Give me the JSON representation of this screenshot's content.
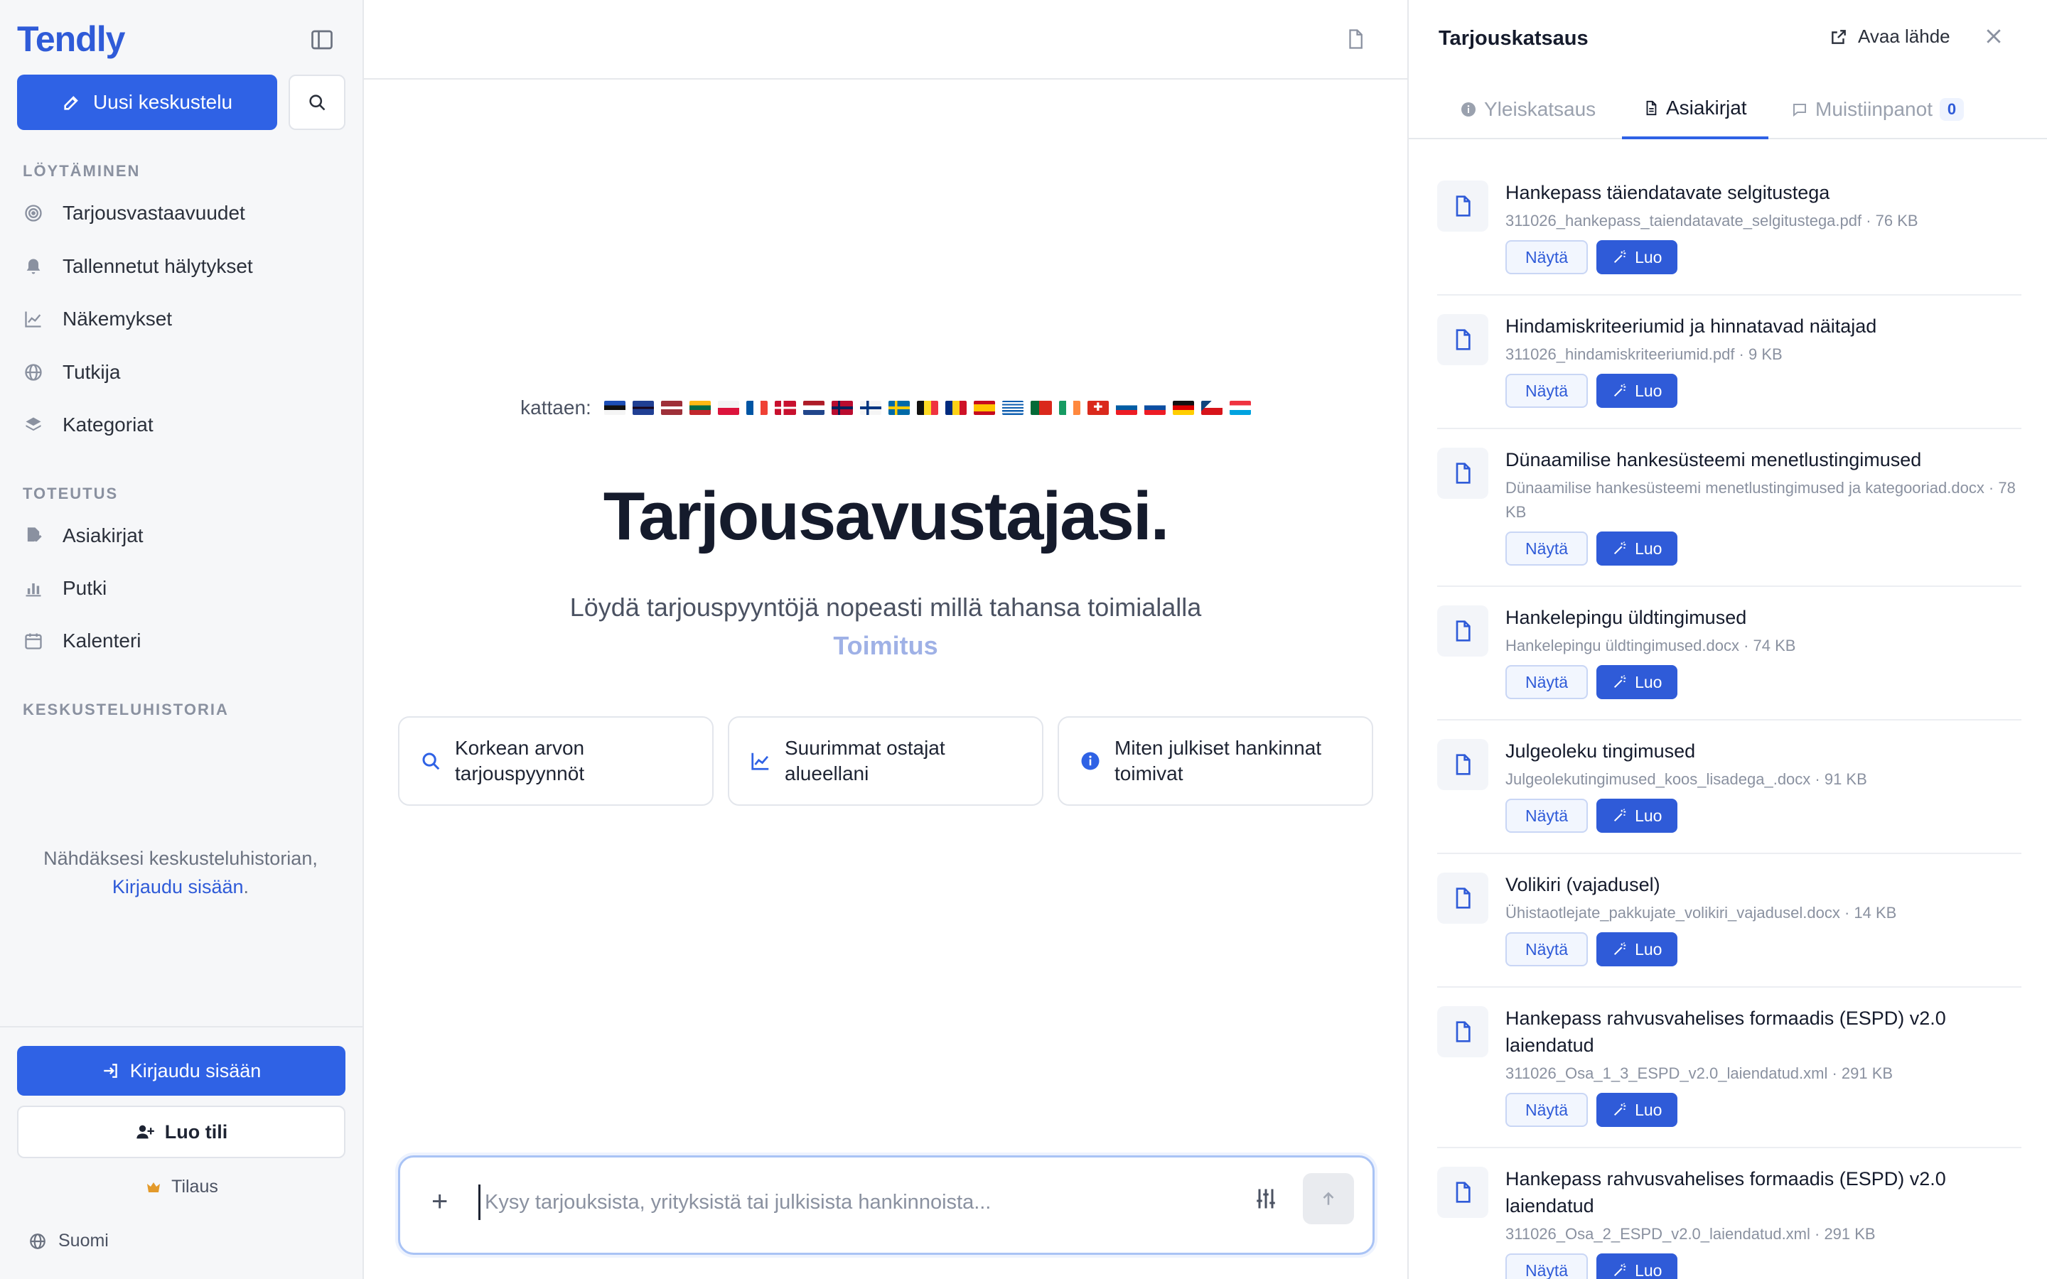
{
  "sidebar": {
    "brand": "Tendly",
    "new_chat": "Uusi keskustelu",
    "section_discover": "LÖYTÄMINEN",
    "nav_discover": [
      {
        "label": "Tarjousvastaavuudet",
        "icon": "target-icon"
      },
      {
        "label": "Tallennetut hälytykset",
        "icon": "bell-icon"
      },
      {
        "label": "Näkemykset",
        "icon": "chart-line-icon"
      },
      {
        "label": "Tutkija",
        "icon": "globe-icon"
      },
      {
        "label": "Kategoriat",
        "icon": "layers-icon"
      }
    ],
    "section_execute": "TOTEUTUS",
    "nav_execute": [
      {
        "label": "Asiakirjat",
        "icon": "document-edit-icon"
      },
      {
        "label": "Putki",
        "icon": "bar-chart-icon"
      },
      {
        "label": "Kalenteri",
        "icon": "calendar-icon"
      }
    ],
    "section_history": "KESKUSTELUHISTORIA",
    "history_msg_prefix": "Nähdäksesi keskusteluhistorian,",
    "history_msg_link": "Kirjaudu sisään",
    "history_msg_suffix": ".",
    "login": "Kirjaudu sisään",
    "create_account": "Luo tili",
    "plan": "Tilaus",
    "language": "Suomi"
  },
  "main": {
    "flags_label": "kattaen:",
    "flags": [
      "EE",
      "GB",
      "LV",
      "LT",
      "PL",
      "FR",
      "DK",
      "NL",
      "NO",
      "FI",
      "SE",
      "BE",
      "RO",
      "ES",
      "GR",
      "PT",
      "IE",
      "CH",
      "SI",
      "SK",
      "DE",
      "CZ",
      "LU"
    ],
    "title": "Tarjousavustajasi.",
    "subtitle": "Löydä tarjouspyyntöjä nopeasti millä tahansa toimialalla",
    "accent": "Toimitus",
    "suggestions": [
      {
        "label": "Korkean arvon tarjouspyynnöt",
        "icon": "search-icon"
      },
      {
        "label": "Suurimmat ostajat alueellani",
        "icon": "chart-line-icon"
      },
      {
        "label": "Miten julkiset hankinnat toimivat",
        "icon": "info-icon"
      }
    ],
    "composer_placeholder": "Kysy tarjouksista, yrityksistä tai julkisista hankinnoista..."
  },
  "panel": {
    "title": "Tarjouskatsaus",
    "open_source": "Avaa lähde",
    "tabs": [
      {
        "label": "Yleiskatsaus",
        "icon": "info-icon"
      },
      {
        "label": "Asiakirjat",
        "icon": "document-icon"
      },
      {
        "label": "Muistiinpanot",
        "icon": "chat-icon",
        "count": "0"
      }
    ],
    "view_label": "Näytä",
    "create_label": "Luo",
    "documents": [
      {
        "name": "Hankepass täiendatavate selgitustega",
        "meta": "311026_hankepass_taiendatavate_selgitustega.pdf · 76 KB"
      },
      {
        "name": "Hindamiskriteeriumid ja hinnatavad näitajad",
        "meta": "311026_hindamiskriteeriumid.pdf · 9 KB"
      },
      {
        "name": "Dünaamilise hankesüsteemi menetlustingimused",
        "meta": "Dünaamilise hankesüsteemi menetlustingimused ja kategooriad.docx · 78 KB"
      },
      {
        "name": "Hankelepingu üldtingimused",
        "meta": "Hankelepingu üldtingimused.docx · 74 KB"
      },
      {
        "name": "Julgeoleku tingimused",
        "meta": "Julgeolekutingimused_koos_lisadega_.docx · 91 KB"
      },
      {
        "name": "Volikiri (vajadusel)",
        "meta": "Ühistaotlejate_pakkujate_volikiri_vajadusel.docx · 14 KB"
      },
      {
        "name": "Hankepass rahvusvahelises formaadis (ESPD) v2.0 laiendatud",
        "meta": "311026_Osa_1_3_ESPD_v2.0_laiendatud.xml · 291 KB"
      },
      {
        "name": "Hankepass rahvusvahelises formaadis (ESPD) v2.0 laiendatud",
        "meta": "311026_Osa_2_ESPD_v2.0_laiendatud.xml · 291 KB"
      }
    ]
  },
  "colors": {
    "accent": "#2f62e5",
    "brand": "#2f5bd8",
    "sidebar_bg": "#f6f7f9",
    "accent_soft": "#9fb1e6"
  }
}
